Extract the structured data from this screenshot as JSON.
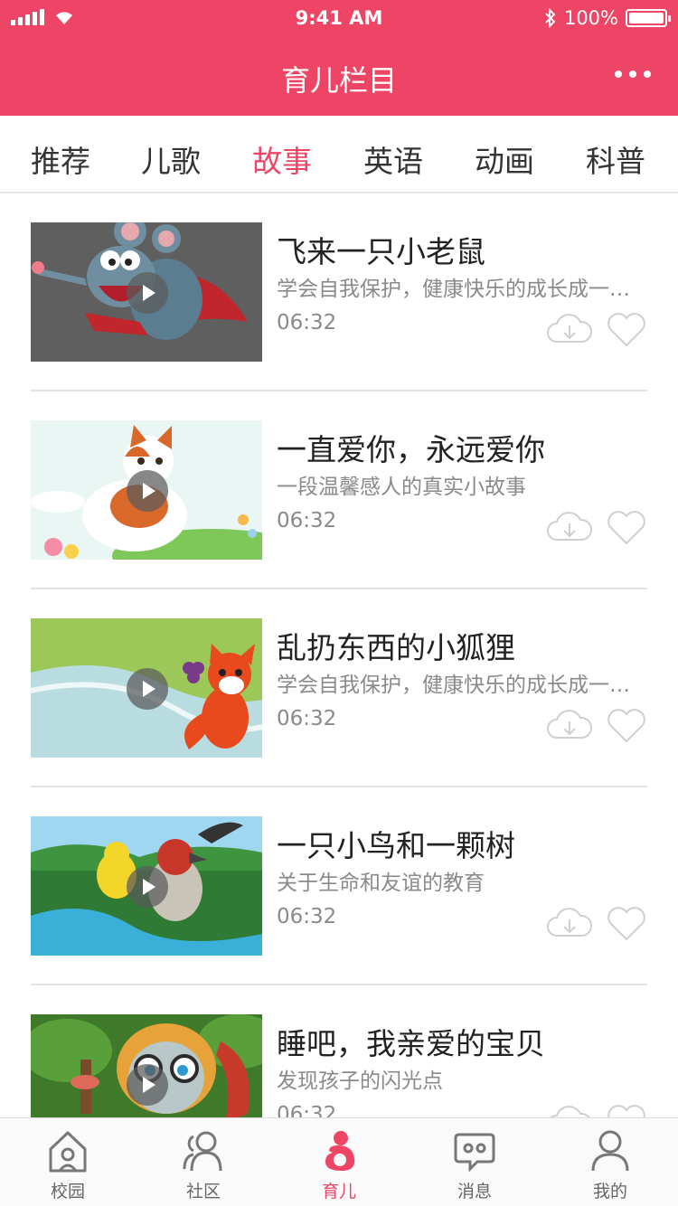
{
  "status_bar": {
    "time": "9:41 AM",
    "battery": "100%"
  },
  "header": {
    "title": "育儿栏目"
  },
  "colors": {
    "accent": "#ee4466",
    "text": "#222222",
    "muted": "#8a8a8a"
  },
  "tabs": [
    {
      "label": "推荐",
      "active": false
    },
    {
      "label": "儿歌",
      "active": false
    },
    {
      "label": "故事",
      "active": true
    },
    {
      "label": "英语",
      "active": false
    },
    {
      "label": "动画",
      "active": false
    },
    {
      "label": "科普",
      "active": false
    }
  ],
  "stories": [
    {
      "title": "飞来一只小老鼠",
      "desc": "学会自我保护，健康快乐的成长成一棵参天大树",
      "duration": "06:32",
      "thumb": "cartoon-mouse"
    },
    {
      "title": "一直爱你，永远爱你",
      "desc": "一段温馨感人的真实小故事",
      "duration": "06:32",
      "thumb": "cartoon-cat"
    },
    {
      "title": "乱扔东西的小狐狸",
      "desc": "学会自我保护，健康快乐的成长成一棵参天大树",
      "duration": "06:32",
      "thumb": "cartoon-fox"
    },
    {
      "title": "一只小鸟和一颗树",
      "desc": "关于生命和友谊的教育",
      "duration": "06:32",
      "thumb": "cartoon-birds"
    },
    {
      "title": "睡吧，我亲爱的宝贝",
      "desc": "发现孩子的闪光点",
      "duration": "06:32",
      "thumb": "cartoon-forest"
    }
  ],
  "tabbar": [
    {
      "label": "校园",
      "icon": "school-icon",
      "active": false
    },
    {
      "label": "社区",
      "icon": "community-icon",
      "active": false
    },
    {
      "label": "育儿",
      "icon": "parenting-icon",
      "active": true
    },
    {
      "label": "消息",
      "icon": "message-icon",
      "active": false
    },
    {
      "label": "我的",
      "icon": "profile-icon",
      "active": false
    }
  ]
}
